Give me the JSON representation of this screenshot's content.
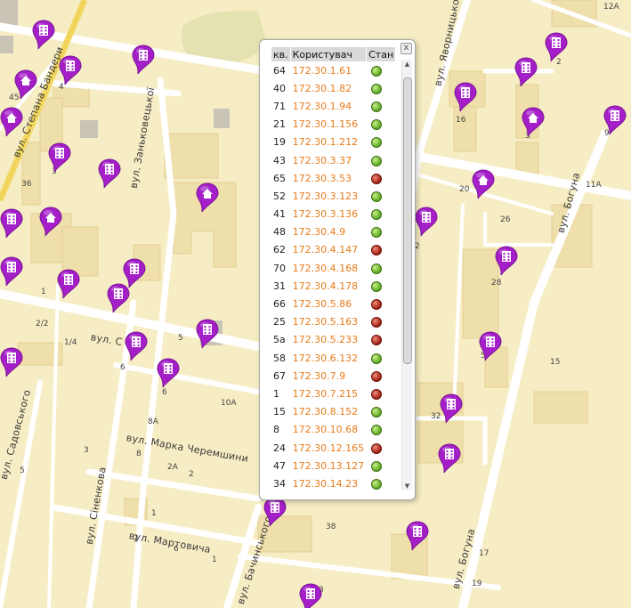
{
  "streets": {
    "bandery": "вул. Степана Бандери",
    "zankovetskoi": "вул. Заньковецької",
    "yavornytskoho": "вул. Яворницького",
    "bohuna_top": "вул. Богуна",
    "bohuna_bottom": "вул. Богуна",
    "sadovskoho": "вул. Садовського",
    "sienkova": "вул. Сіненкова",
    "cheremshyny": "вул. Марка Черемшини",
    "martovycha": "вул. Мартовича",
    "bachynskoho": "вул. Бачинського",
    "partial": "вул. С"
  },
  "house_numbers": [
    "12А",
    "45",
    "4",
    "16",
    "3",
    "2",
    "3",
    "36",
    "20",
    "26",
    "11А",
    "28",
    "2",
    "1",
    "5",
    "2/2",
    "1/4",
    "5",
    "6",
    "15",
    "6",
    "10А",
    "32",
    "8А",
    "8",
    "3",
    "2А",
    "2",
    "4",
    "5",
    "1",
    "2",
    "6",
    "38",
    "17",
    "3",
    "19",
    "9",
    "1"
  ],
  "popup": {
    "close_label": "x",
    "headers": {
      "kv": "кв.",
      "user": "Користувач",
      "status": "Стан"
    },
    "rows": [
      {
        "kv": "64",
        "user": "172.30.1.61",
        "status": "green"
      },
      {
        "kv": "40",
        "user": "172.30.1.82",
        "status": "green"
      },
      {
        "kv": "71",
        "user": "172.30.1.94",
        "status": "green"
      },
      {
        "kv": "21",
        "user": "172.30.1.156",
        "status": "green"
      },
      {
        "kv": "19",
        "user": "172.30.1.212",
        "status": "green"
      },
      {
        "kv": "43",
        "user": "172.30.3.37",
        "status": "green"
      },
      {
        "kv": "65",
        "user": "172.30.3.53",
        "status": "red"
      },
      {
        "kv": "52",
        "user": "172.30.3.123",
        "status": "green"
      },
      {
        "kv": "41",
        "user": "172.30.3.136",
        "status": "green"
      },
      {
        "kv": "48",
        "user": "172.30.4.9",
        "status": "green"
      },
      {
        "kv": "62",
        "user": "172.30.4.147",
        "status": "red"
      },
      {
        "kv": "70",
        "user": "172.30.4.168",
        "status": "green"
      },
      {
        "kv": "31",
        "user": "172.30.4.178",
        "status": "green"
      },
      {
        "kv": "66",
        "user": "172.30.5.86",
        "status": "red"
      },
      {
        "kv": "25",
        "user": "172.30.5.163",
        "status": "red"
      },
      {
        "kv": "5а",
        "user": "172.30.5.233",
        "status": "red"
      },
      {
        "kv": "58",
        "user": "172.30.6.132",
        "status": "green"
      },
      {
        "kv": "67",
        "user": "172.30.7.9",
        "status": "red"
      },
      {
        "kv": "1",
        "user": "172.30.7.215",
        "status": "red"
      },
      {
        "kv": "15",
        "user": "172.30.8.152",
        "status": "green"
      },
      {
        "kv": "8",
        "user": "172.30.10.68",
        "status": "green"
      },
      {
        "kv": "24",
        "user": "172.30.12.165",
        "status": "red"
      },
      {
        "kv": "47",
        "user": "172.30.13.127",
        "status": "green"
      },
      {
        "kv": "34",
        "user": "172.30.14.23",
        "status": "green"
      }
    ]
  },
  "colors": {
    "map_background": "#f7edc4",
    "road": "#ffffff",
    "marker": "#a51fc9",
    "ip_text": "#e87c1a",
    "status_ok": "#5aa81e",
    "status_off": "#a01c10"
  },
  "markers": [
    {
      "icon": "apartment-building-icon"
    },
    {
      "icon": "house-icon"
    },
    {
      "icon": "apartment-building-icon"
    },
    {
      "icon": "apartment-building-icon"
    },
    {
      "icon": "house-icon"
    },
    {
      "icon": "apartment-building-icon"
    },
    {
      "icon": "apartment-building-icon"
    },
    {
      "icon": "house-icon"
    },
    {
      "icon": "apartment-building-icon"
    },
    {
      "icon": "apartment-building-icon"
    },
    {
      "icon": "apartment-building-icon"
    },
    {
      "icon": "apartment-building-icon"
    },
    {
      "icon": "apartment-building-icon"
    },
    {
      "icon": "house-icon"
    },
    {
      "icon": "apartment-building-icon"
    },
    {
      "icon": "apartment-building-icon"
    },
    {
      "icon": "apartment-building-icon"
    },
    {
      "icon": "apartment-building-icon"
    },
    {
      "icon": "house-icon"
    },
    {
      "icon": "apartment-building-icon"
    },
    {
      "icon": "apartment-building-icon"
    },
    {
      "icon": "apartment-building-icon"
    },
    {
      "icon": "apartment-building-icon"
    },
    {
      "icon": "apartment-building-icon"
    },
    {
      "icon": "apartment-building-icon"
    },
    {
      "icon": "apartment-building-icon"
    },
    {
      "icon": "apartment-building-icon"
    },
    {
      "icon": "apartment-building-icon"
    },
    {
      "icon": "house-icon"
    },
    {
      "icon": "apartment-building-icon"
    },
    {
      "icon": "apartment-building-icon"
    },
    {
      "icon": "apartment-building-icon"
    }
  ]
}
